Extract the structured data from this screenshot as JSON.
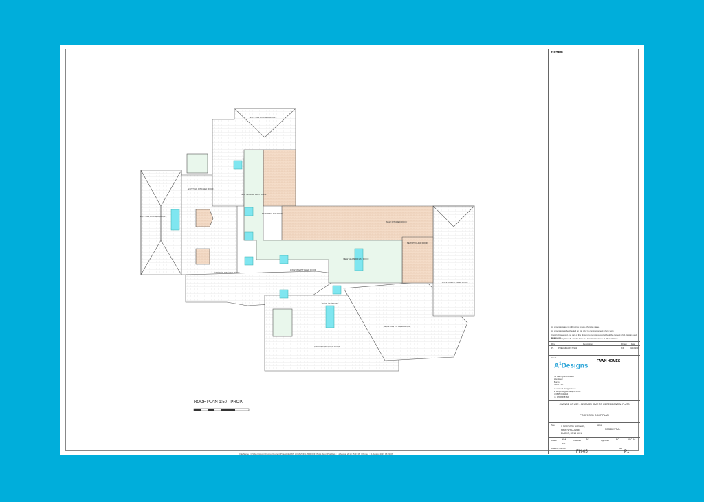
{
  "sheet": {
    "notes_heading": "NOTES:",
    "general_notes": [
      "All dimensions are in millimetres unless otherwise stated.",
      "All dimensions to be checked on site prior to commencement of any work.",
      "Copyright reserved - no part of this drawing to be reproduced without the consent of A1 Designs and Drafting ltd."
    ],
    "revision_key": "P - Preliminary Issue  T - Tender Issue  C - Construction Issue  R - Record Issue",
    "revision_headers": [
      "Rev",
      "Description",
      "Drawn",
      "Date"
    ],
    "revision_row": [
      "P1",
      "PRELIMINARY ISSUE",
      "KM",
      "01/10/2019"
    ],
    "client_label": "Client",
    "client_name": "FAWN HOMES",
    "logo_a": "A",
    "logo_one": "1",
    "logo_text": "Designs",
    "company_address": [
      "54 Carrington Crescent",
      "Wendover",
      "Bucks",
      "HP22 6AN"
    ],
    "company_contact": [
      "w: www.a1-designs.co.uk",
      "e: enquiries@a1-designs.co.uk",
      "t: 0845 0944464",
      "m: 07968668766"
    ],
    "project": "CHANGE OF USE - C2 CARE HOME TO C3 RESIDENTIAL FLATS",
    "drawing_title": "PROPOSED ROOF PLAN",
    "site_label": "Site",
    "site_address": [
      "7 RECTORY AVENUE,",
      "HIGH WYCOMBE,",
      "BUCKS, HP13 6HN"
    ],
    "status_label": "Status",
    "status": "RESIDENTIAL",
    "drawn_label": "Drawn",
    "drawn": "KM",
    "checked_label": "Checked",
    "checked": "PC",
    "approved_label": "Approved",
    "approved": "PC",
    "size": "ISO A1",
    "fee_label": "N/A",
    "drawing_number_label": "Drawing Number",
    "drawing_number": "FH-05",
    "rev_label": "Rev",
    "revision": "P1",
    "roof_plan_title": "ROOF PLAN 1:50 - PROP.",
    "footer": "File Name : C:\\Users\\Anon\\Dropbox\\Current Projects\\FAWN HOMES\\FH-05 ROOF PLAN.dwg  |  Plot Date : 11 August 2019 15:23:05  |  Printed : 11 August 2019 15:23:06"
  },
  "roof_labels": [
    "EXISTING PITCHED ROOF",
    "EXISTING PITCHED ROOF",
    "EXISTING PITCHED ROOF",
    "NEW GLAZED FLAT ROOF",
    "NEW PITCHED ROOF",
    "NEW PITCHED ROOF",
    "NEW PITCHED ROOF",
    "NEW GLAZED FLAT ROOF",
    "EXISTING PITCHED ROOF",
    "EXISTING PITCHED ROOF",
    "EXISTING PITCHED ROOF",
    "EXISTING PITCHED ROOF",
    "EXISTING PITCHED ROOF",
    "NEW LANTERN"
  ],
  "colors": {
    "background": "#00aedb",
    "existing_roof": "#ffffff",
    "new_pitched_roof": "#f4dcc8",
    "flat_roof": "#e9f7ec",
    "rooflight": "#7fe6f0"
  }
}
